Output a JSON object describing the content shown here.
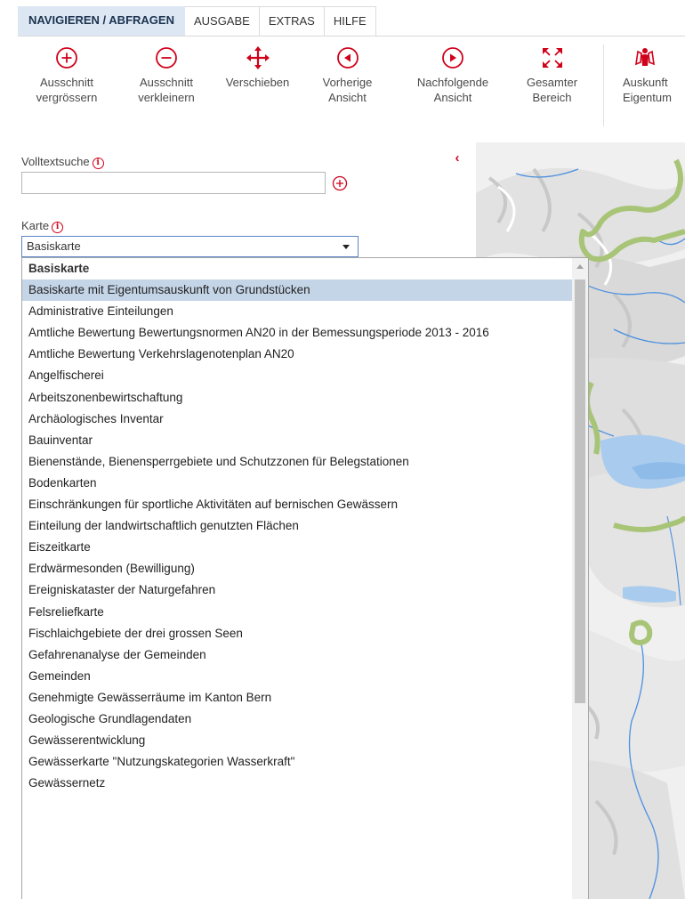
{
  "tabs": [
    {
      "label": "NAVIGIEREN / ABFRAGEN",
      "active": true
    },
    {
      "label": "AUSGABE",
      "active": false
    },
    {
      "label": "EXTRAS",
      "active": false
    },
    {
      "label": "HILFE",
      "active": false
    }
  ],
  "toolbar": {
    "zoom_in": {
      "line1": "Ausschnitt",
      "line2": "vergrössern",
      "icon": "zoom-in-icon"
    },
    "zoom_out": {
      "line1": "Ausschnitt",
      "line2": "verkleinern",
      "icon": "zoom-out-icon"
    },
    "pan": {
      "line1": "Verschieben",
      "line2": "",
      "icon": "move-arrows-icon"
    },
    "previous": {
      "line1": "Vorherige",
      "line2": "Ansicht",
      "icon": "previous-view-icon"
    },
    "next": {
      "line1": "Nachfolgende",
      "line2": "Ansicht",
      "icon": "next-view-icon"
    },
    "full_extent": {
      "line1": "Gesamter",
      "line2": "Bereich",
      "icon": "full-extent-icon"
    },
    "owner_info": {
      "line1": "Auskunft",
      "line2": "Eigentum",
      "icon": "owner-info-icon"
    },
    "accent_color": "#d0021b"
  },
  "panel": {
    "collapse_glyph": "‹",
    "search_label": "Volltextsuche",
    "search_value": "",
    "info_glyph": "i",
    "map_label": "Karte",
    "map_selected": "Basiskarte"
  },
  "dropdown": {
    "items": [
      {
        "label": "Basiskarte",
        "group": true
      },
      {
        "label": "Basiskarte mit Eigentumsauskunft von Grundstücken",
        "selected": true
      },
      {
        "label": "Administrative Einteilungen"
      },
      {
        "label": "Amtliche Bewertung Bewertungsnormen AN20 in der Bemessungsperiode 2013 - 2016"
      },
      {
        "label": "Amtliche Bewertung Verkehrslagenotenplan AN20"
      },
      {
        "label": "Angelfischerei"
      },
      {
        "label": "Arbeitszonenbewirtschaftung"
      },
      {
        "label": "Archäologisches Inventar"
      },
      {
        "label": "Bauinventar"
      },
      {
        "label": "Bienenstände, Bienensperrgebiete und Schutzzonen für Belegstationen"
      },
      {
        "label": "Bodenkarten"
      },
      {
        "label": "Einschränkungen für sportliche Aktivitäten auf bernischen Gewässern"
      },
      {
        "label": "Einteilung der landwirtschaftlich genutzten Flächen"
      },
      {
        "label": "Eiszeitkarte"
      },
      {
        "label": "Erdwärmesonden (Bewilligung)"
      },
      {
        "label": "Ereigniskataster der Naturgefahren"
      },
      {
        "label": "Felsreliefkarte"
      },
      {
        "label": "Fischlaichgebiete der drei grossen Seen"
      },
      {
        "label": "Gefahrenanalyse der Gemeinden"
      },
      {
        "label": "Gemeinden"
      },
      {
        "label": "Genehmigte Gewässerräume im Kanton Bern"
      },
      {
        "label": "Geologische Grundlagendaten"
      },
      {
        "label": "Gewässerentwicklung"
      },
      {
        "label": "Gewässerkarte \"Nutzungskategorien Wasserkraft\""
      },
      {
        "label": "Gewässernetz"
      }
    ]
  },
  "map_colors": {
    "relief": "#e9e9e9",
    "boundary": "#a8c477",
    "water": "#a9cbee",
    "river": "#4a8fe0"
  }
}
